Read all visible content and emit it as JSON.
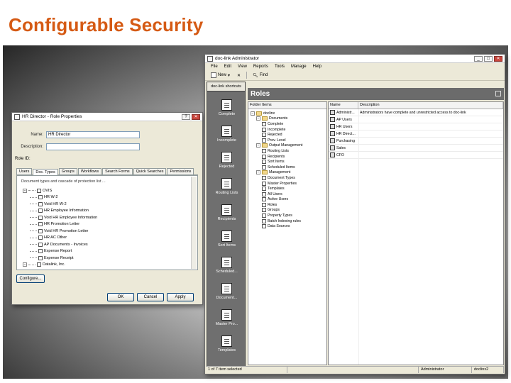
{
  "slide": {
    "title": "Configurable Security"
  },
  "role_dialog": {
    "title": "HR Director - Role Properties",
    "name_label": "Name:",
    "name_value": "HR Director",
    "description_label": "Description:",
    "description_value": "",
    "role_id_label": "Role ID:",
    "tabs": [
      "Users",
      "Doc. Types",
      "Groups",
      "Workflows",
      "Search Forms",
      "Quick Searches",
      "Permissions"
    ],
    "active_tab": "Doc. Types",
    "hint": "Document types and cascade of protection list ...",
    "tree": [
      {
        "label": "OVIS",
        "level": 0,
        "type": "root"
      },
      {
        "label": "HR W-2",
        "level": 1
      },
      {
        "label": "Void HR W-2",
        "level": 1
      },
      {
        "label": "HR Employee Information",
        "level": 1
      },
      {
        "label": "Void HR Employee Information",
        "level": 1
      },
      {
        "label": "HR Promotion Letter",
        "level": 1
      },
      {
        "label": "Void HR Promotion Letter",
        "level": 1
      },
      {
        "label": "HR AC Other",
        "level": 1
      },
      {
        "label": "AP Documents - Invoices",
        "level": 1
      },
      {
        "label": "Expense Report",
        "level": 1
      },
      {
        "label": "Expense Receipt",
        "level": 1
      },
      {
        "label": "Datalink, Inc.",
        "level": 0,
        "type": "root"
      }
    ],
    "configure_button": "Configure...",
    "ok_button": "OK",
    "cancel_button": "Cancel",
    "apply_button": "Apply"
  },
  "admin_window": {
    "title": "doc-link Administrator",
    "menu": [
      "File",
      "Edit",
      "View",
      "Reports",
      "Tools",
      "Manage",
      "Help"
    ],
    "toolbar": {
      "new_label": "New",
      "find_label": "Find"
    },
    "nav_header": "doc-link shortcuts",
    "nav_items": [
      "Complete",
      "Incomplete",
      "Rejected",
      "Routing Lists",
      "Recipients",
      "Sort Items",
      "Scheduled...",
      "Document...",
      "Master Pro...",
      "Templates"
    ],
    "section_title": "Roles",
    "tree_header": "Folder Items",
    "tree": [
      {
        "label": "doclinx",
        "level": 0,
        "icon": "root"
      },
      {
        "label": "Documents",
        "level": 1,
        "icon": "folder"
      },
      {
        "label": "Complete",
        "level": 2,
        "icon": "doc"
      },
      {
        "label": "Incomplete",
        "level": 2,
        "icon": "doc"
      },
      {
        "label": "Rejected",
        "level": 2,
        "icon": "doc"
      },
      {
        "label": "Prev. Level",
        "level": 2,
        "icon": "doc"
      },
      {
        "label": "Output Management",
        "level": 1,
        "icon": "folder"
      },
      {
        "label": "Routing Lists",
        "level": 2,
        "icon": "doc"
      },
      {
        "label": "Recipients",
        "level": 2,
        "icon": "doc"
      },
      {
        "label": "Sort Items",
        "level": 2,
        "icon": "doc"
      },
      {
        "label": "Scheduled Items",
        "level": 2,
        "icon": "doc"
      },
      {
        "label": "Management",
        "level": 1,
        "icon": "folder"
      },
      {
        "label": "Document Types",
        "level": 2,
        "icon": "doc"
      },
      {
        "label": "Master Properties",
        "level": 2,
        "icon": "doc"
      },
      {
        "label": "Templates",
        "level": 2,
        "icon": "doc"
      },
      {
        "label": "All Users",
        "level": 2,
        "icon": "doc"
      },
      {
        "label": "Active Users",
        "level": 2,
        "icon": "doc"
      },
      {
        "label": "Roles",
        "level": 2,
        "icon": "doc"
      },
      {
        "label": "Groups",
        "level": 2,
        "icon": "doc"
      },
      {
        "label": "Property Types",
        "level": 2,
        "icon": "doc"
      },
      {
        "label": "Batch Indexing rules",
        "level": 2,
        "icon": "doc"
      },
      {
        "label": "Data Sources",
        "level": 2,
        "icon": "doc"
      }
    ],
    "columns": [
      "Name",
      "Description"
    ],
    "roles": [
      {
        "name": "Administr...",
        "description": "Administrators have complete and unrestricted access to doc-link"
      },
      {
        "name": "AP Users",
        "description": ""
      },
      {
        "name": "HR Users",
        "description": ""
      },
      {
        "name": "HR Direct...",
        "description": ""
      },
      {
        "name": "Purchasing",
        "description": ""
      },
      {
        "name": "Sales",
        "description": ""
      },
      {
        "name": "CFO",
        "description": ""
      }
    ],
    "status": {
      "selection": "1 of 7 item selected",
      "user": "Administrator",
      "server": "doclinx2"
    }
  }
}
